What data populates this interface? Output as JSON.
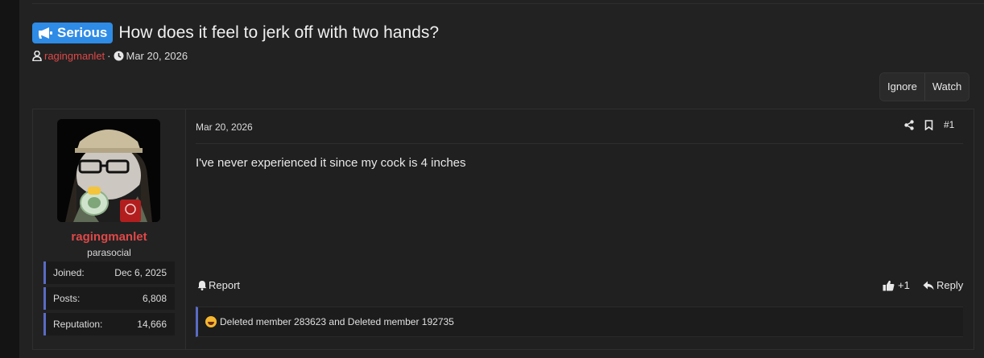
{
  "thread": {
    "prefix_label": "Serious",
    "title": "How does it feel to jerk off with two hands?",
    "author": "ragingmanlet",
    "meta_sep": "·",
    "date": "Mar 20, 2026"
  },
  "actions": {
    "ignore_label": "Ignore",
    "watch_label": "Watch"
  },
  "post": {
    "date": "Mar 20, 2026",
    "number": "#1",
    "body": "I've never experienced it since my cock is 4 inches",
    "report_label": "Report",
    "react_count": "+1",
    "reply_label": "Reply",
    "reactions_text": "Deleted member 283623 and Deleted member 192735"
  },
  "user": {
    "name": "ragingmanlet",
    "title": "parasocial",
    "stats": [
      {
        "label": "Joined:",
        "value": "Dec 6, 2025"
      },
      {
        "label": "Posts:",
        "value": "6,808"
      },
      {
        "label": "Reputation:",
        "value": "14,666"
      }
    ]
  },
  "colors": {
    "prefix_bg": "#2e8be6",
    "username": "#e04848",
    "accent_bar": "#5a6bc4",
    "background": "#222222"
  },
  "icons": [
    "megaphone-icon",
    "user-icon",
    "clock-icon",
    "share-icon",
    "bookmark-icon",
    "bell-icon",
    "thumbs-up-icon",
    "reply-icon",
    "laughing-emoji-icon"
  ]
}
